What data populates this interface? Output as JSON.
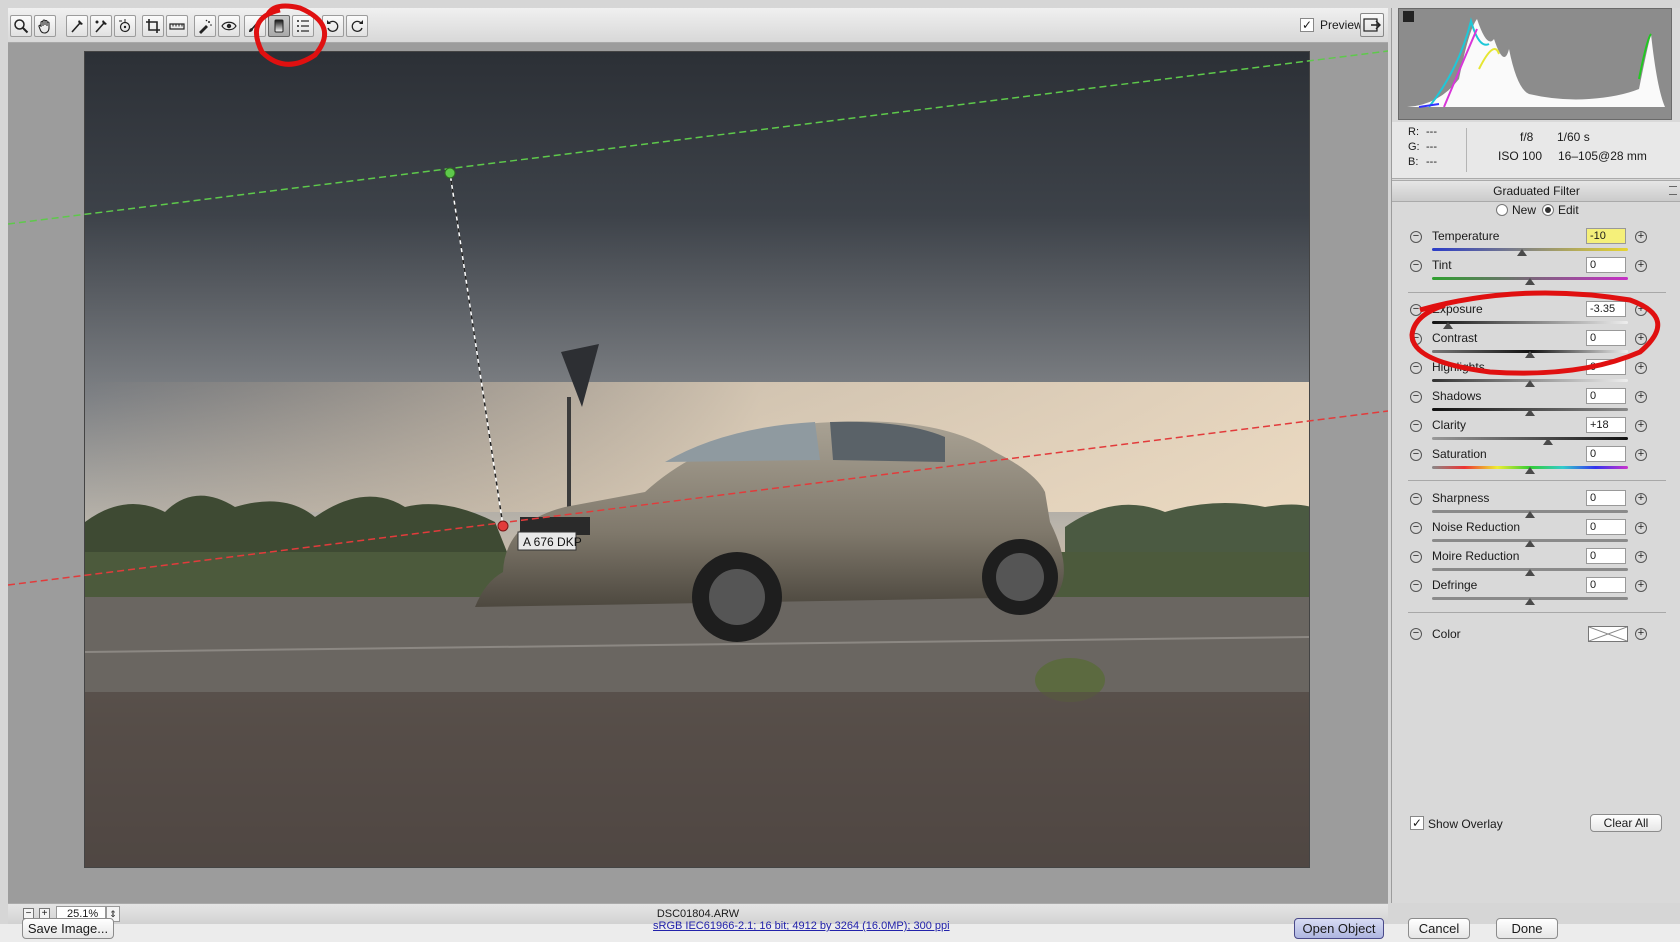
{
  "toolbar": {
    "tools": [
      "zoom-icon",
      "hand-icon",
      "white-balance-icon",
      "color-sampler-icon",
      "target-adjustment-icon",
      "crop-icon",
      "straighten-icon",
      "spot-removal-icon",
      "red-eye-icon",
      "adjustment-brush-icon",
      "graduated-filter-icon",
      "radial-filter-icon",
      "rotate-ccw-icon",
      "rotate-cw-icon"
    ],
    "active_tool": "graduated-filter-icon",
    "preview_label": "Preview",
    "preview_checked": true
  },
  "status": {
    "zoom": "25.1%",
    "filename": "DSC01804.ARW"
  },
  "info": {
    "r_label": "R:",
    "r_value": "---",
    "g_label": "G:",
    "g_value": "---",
    "b_label": "B:",
    "b_value": "---",
    "aperture": "f/8",
    "shutter": "1/60 s",
    "iso": "ISO 100",
    "lens": "16–105@28 mm"
  },
  "panel": {
    "title": "Graduated Filter",
    "mode_new": "New",
    "mode_edit": "Edit",
    "mode_selected": "Edit",
    "adjustments": {
      "temperature": {
        "label": "Temperature",
        "value": "-10",
        "level": 0.46
      },
      "tint": {
        "label": "Tint",
        "value": "0",
        "level": 0.5
      },
      "exposure": {
        "label": "Exposure",
        "value": "-3.35",
        "level": 0.08
      },
      "contrast": {
        "label": "Contrast",
        "value": "0",
        "level": 0.5
      },
      "highlights": {
        "label": "Highlights",
        "value": "0",
        "level": 0.5
      },
      "shadows": {
        "label": "Shadows",
        "value": "0",
        "level": 0.5
      },
      "clarity": {
        "label": "Clarity",
        "value": "+18",
        "level": 0.59
      },
      "saturation": {
        "label": "Saturation",
        "value": "0",
        "level": 0.5
      },
      "sharpness": {
        "label": "Sharpness",
        "value": "0",
        "level": 0.5
      },
      "noise_reduction": {
        "label": "Noise Reduction",
        "value": "0",
        "level": 0.5
      },
      "moire_reduction": {
        "label": "Moire Reduction",
        "value": "0",
        "level": 0.5
      },
      "defringe": {
        "label": "Defringe",
        "value": "0",
        "level": 0.5
      }
    },
    "color_label": "Color",
    "show_overlay_label": "Show Overlay",
    "show_overlay_checked": true,
    "clear_all_label": "Clear All"
  },
  "bottom": {
    "save_label": "Save Image...",
    "workflow_link": "sRGB IEC61966-2.1; 16 bit; 4912 by 3264 (16.0MP); 300 ppi",
    "open_label": "Open Object",
    "cancel_label": "Cancel",
    "done_label": "Done"
  },
  "photo": {
    "plate": "A 676 DKP"
  },
  "colors": {
    "green_guide": "#5ec94b",
    "red_guide": "#e23b3b",
    "annotation_red": "#e01010",
    "highlight_field": "#f5f07a"
  }
}
